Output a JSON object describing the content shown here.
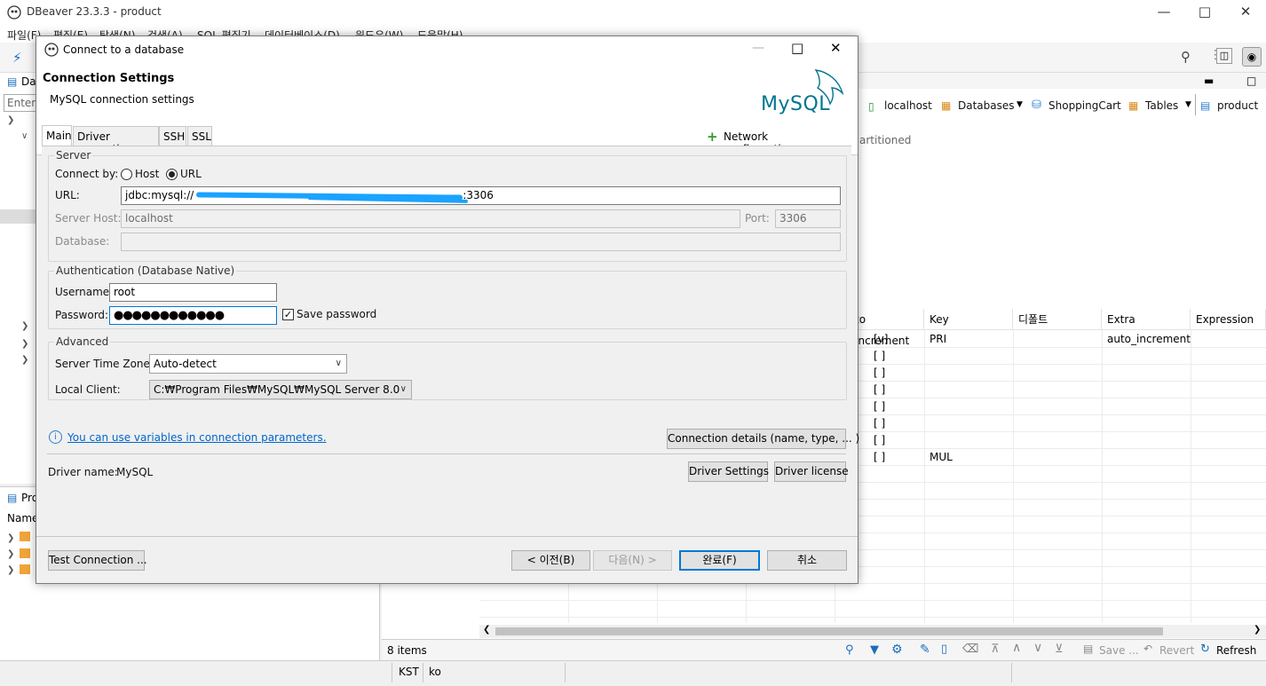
{
  "app": {
    "title": "DBeaver 23.3.3 - product",
    "menu": [
      "파일(F)",
      "편집(E)",
      "탐색(N)",
      "검색(A)",
      "SQL 편집기",
      "데이터베이스(D)",
      "윈도우(W)",
      "도움말(H)"
    ]
  },
  "left": {
    "panel_label": "Dat",
    "filter_placeholder": "Enter a",
    "project_label": "Pro",
    "name_col": "Name"
  },
  "editor": {
    "breadcrumbs": [
      "localhost",
      "Databases",
      "ShoppingCart",
      "Tables",
      "product"
    ],
    "partitioned_text": "artitioned",
    "grid": {
      "headers": [
        "to Increment",
        "Key",
        "디폴트",
        "Extra",
        "Expression"
      ],
      "rows": [
        [
          "[v]",
          "PRI",
          "",
          "auto_increment",
          ""
        ],
        [
          "[ ]",
          "",
          "",
          "",
          ""
        ],
        [
          "[ ]",
          "",
          "",
          "",
          ""
        ],
        [
          "[ ]",
          "",
          "",
          "",
          ""
        ],
        [
          "[ ]",
          "",
          "",
          "",
          ""
        ],
        [
          "[ ]",
          "",
          "",
          "",
          ""
        ],
        [
          "[ ]",
          "",
          "",
          "",
          ""
        ],
        [
          "[ ]",
          "MUL",
          "",
          "",
          ""
        ]
      ]
    },
    "status": {
      "items": "8 items",
      "save": "Save ...",
      "revert": "Revert",
      "refresh": "Refresh"
    }
  },
  "bottom": {
    "tz": "KST",
    "lang": "ko"
  },
  "dialog": {
    "title": "Connect to a database",
    "header_title": "Connection Settings",
    "header_sub": "MySQL connection settings",
    "logo_text": "MySQL",
    "tabs": [
      "Main",
      "Driver properties",
      "SSH",
      "SSL"
    ],
    "network_config": "Network configurations...",
    "server": {
      "group": "Server",
      "connect_by": "Connect by:",
      "host_radio": "Host",
      "url_radio": "URL",
      "selected": "URL",
      "url_label": "URL:",
      "url_value_prefix": "jdbc:mysql://",
      "url_value_suffix": ":3306",
      "host_label": "Server Host:",
      "host_value": "localhost",
      "port_label": "Port:",
      "port_value": "3306",
      "db_label": "Database:",
      "db_value": ""
    },
    "auth": {
      "group": "Authentication (Database Native)",
      "username_label": "Username:",
      "username_value": "root",
      "password_label": "Password:",
      "password_value": "●●●●●●●●●●●●",
      "save_password": "Save password",
      "save_checked": true
    },
    "advanced": {
      "group": "Advanced",
      "tz_label": "Server Time Zone:",
      "tz_value": "Auto-detect",
      "client_label": "Local Client:",
      "client_value": "C:₩Program Files₩MySQL₩MySQL Server 8.0"
    },
    "info_link": "You can use variables in connection parameters.",
    "conn_details_btn": "Connection details (name, type, ... )",
    "driver_name_label": "Driver name:",
    "driver_name_value": "MySQL",
    "driver_settings_btn": "Driver Settings",
    "driver_license_btn": "Driver license",
    "test_btn": "Test Connection ...",
    "back_btn": "< 이전(B)",
    "next_btn": "다음(N) >",
    "finish_btn": "완료(F)",
    "cancel_btn": "취소"
  },
  "colors": {
    "accent": "#0078d7",
    "link": "#0066cc",
    "mysql_blue": "#00758f",
    "mysql_orange": "#f29111"
  }
}
